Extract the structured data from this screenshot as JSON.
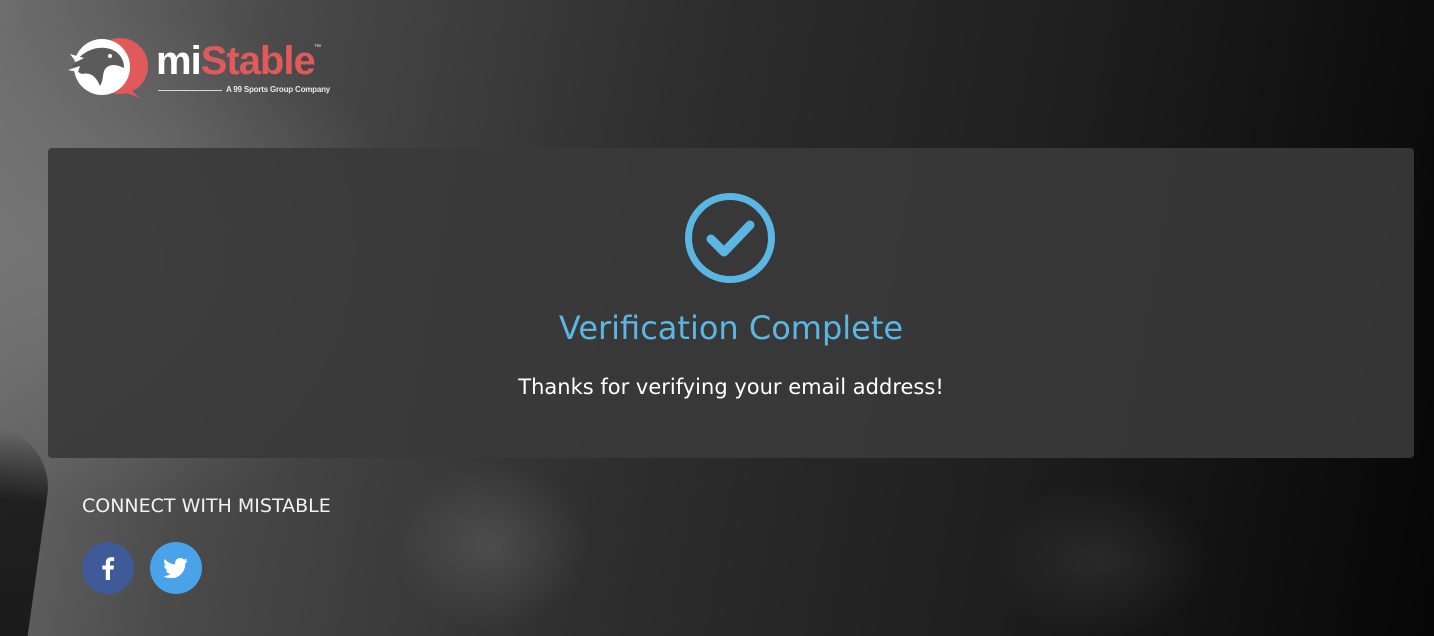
{
  "brand": {
    "name_part1": "mi",
    "name_part2": "Stable",
    "trademark": "™",
    "tagline": "A 99 Sports Group Company",
    "accent_color": "#e05a5c"
  },
  "verification": {
    "icon": "check-circle-icon",
    "title": "Verification Complete",
    "message": "Thanks for verifying your email address!",
    "accent_color": "#5ab7e3"
  },
  "footer": {
    "connect_label": "CONNECT WITH MISTABLE",
    "social": [
      {
        "name": "Facebook",
        "icon": "facebook-icon",
        "color": "#3f5a99"
      },
      {
        "name": "Twitter",
        "icon": "twitter-icon",
        "color": "#4aa3e8"
      }
    ]
  }
}
